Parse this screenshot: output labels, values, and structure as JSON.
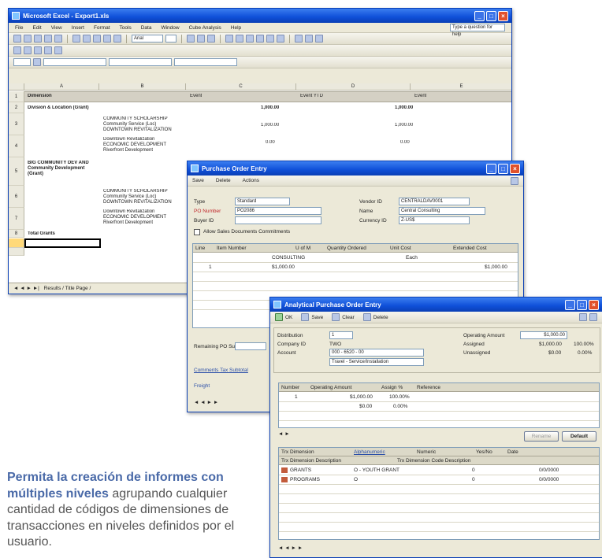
{
  "excel": {
    "title": "Microsoft Excel - Export1.xls",
    "menu": [
      "File",
      "Edit",
      "View",
      "Insert",
      "Format",
      "Tools",
      "Data",
      "Window",
      "Cube Analysis",
      "Help"
    ],
    "help_box": "Type a question for help",
    "font_name": "Arial",
    "columns": [
      "A",
      "B",
      "C",
      "D",
      "E"
    ],
    "rows": [
      {
        "num": "1",
        "a": "Dimension",
        "b": "Event",
        "c": "Event YTD",
        "d": "Event"
      },
      {
        "num": "2",
        "a": "Division & Location (Grant)",
        "b": "",
        "c": "1,000.00",
        "d": "1,000.00"
      },
      {
        "num": "3",
        "a": "",
        "b": "COMMUNITY SCHOLARSHIP\nCommunity Service (Loc)\nDOWNTOWN REVITALIZATION",
        "c": "1,000.00",
        "d": "1,000.00"
      },
      {
        "num": "4",
        "a": "",
        "b": "Downtown Revitalization\nECONOMIC DEVELOPMENT\nRiverfront Development",
        "c": "0.00",
        "d": "0.00"
      },
      {
        "num": "5",
        "a": "BIG COMMUNITY DEV AND\nCommunity Development\n(Grant)",
        "b": "",
        "c": "",
        "d": ""
      },
      {
        "num": "6",
        "a": "",
        "b": "COMMUNITY SCHOLARSHIP\nCommunity Service (Loc)\nDOWNTOWN REVITALIZATION",
        "c": "",
        "d": ""
      },
      {
        "num": "7",
        "a": "",
        "b": "Downtown Revitalization\nECONOMIC DEVELOPMENT\nRiverfront Development",
        "c": "",
        "d": ""
      },
      {
        "num": "8",
        "a": "Total Grants",
        "b": "",
        "c": "",
        "d": ""
      }
    ],
    "sheet_tab": "Results / Title Page /"
  },
  "po_entry": {
    "title": "Purchase Order Entry",
    "actions": [
      "Save",
      "Delete",
      "Actions"
    ],
    "fields": {
      "type_label": "Type",
      "type_value": "Standard",
      "po_number_label": "PO Number",
      "po_number_value": "PO2086",
      "buyer_label": "Buyer ID",
      "vendor_label": "Vendor ID",
      "vendor_value": "CENTRALDAV0001",
      "name_label": "Name",
      "name_value": "Central Consulting",
      "currency_label": "Currency ID",
      "currency_value": "Z-US$"
    },
    "allow_sales_docs": "Allow Sales Documents Commitments",
    "grid_headers": [
      "Line",
      "Item Number",
      "U of M",
      "Quantity Ordered",
      "Unit Cost",
      "Extended Cost"
    ],
    "grid_row": {
      "item": "CONSULTING",
      "uom": "Each",
      "qty": "1",
      "cost": "$1,000.00",
      "ext": "$1,000.00"
    },
    "remaining_label": "Remaining PO Subtotal",
    "tax_label": "Comments Tax Subtotal",
    "freight_label": "Freight"
  },
  "analytical": {
    "title": "Analytical Purchase Order Entry",
    "toolbar": [
      "OK",
      "Save",
      "Clear",
      "Delete"
    ],
    "fields": {
      "distribution_label": "Distribution",
      "distribution_value": "1",
      "company_label": "Company ID",
      "company_value": "TWO",
      "account_label": "Account",
      "account_value": "000 - 6520 - 00",
      "account_desc": "Travel - Service/Installation",
      "operating_amount_label": "Operating Amount",
      "operating_amount_value": "$1,000.00",
      "assigned_label": "Assigned",
      "assigned_value": "$1,000.00",
      "assigned_pct": "100.00%",
      "unassigned_label": "Unassigned",
      "unassigned_value": "$0.00",
      "unassigned_pct": "0.00%"
    },
    "assign_headers": [
      "Number",
      "Operating Amount",
      "Assign %",
      "Reference"
    ],
    "assign_rows": [
      {
        "num": "1",
        "amount": "$1,000.00",
        "pct": "100.00%"
      },
      {
        "num": "",
        "amount": "$0.00",
        "pct": "0.00%"
      }
    ],
    "buttons": [
      "Rename",
      "Default"
    ],
    "dim_headers": [
      "Trx Dimension",
      "Alphanumeric",
      "Numeric",
      "Yes/No",
      "Date"
    ],
    "dim_headers2": [
      "Trx Dimension Description",
      "Trx Dimension Code Description"
    ],
    "dim_rows": [
      {
        "dim": "GRANTS",
        "code": "O - YOUTH GRANT",
        "num": "0",
        "date": "0/0/0000"
      },
      {
        "dim": "PROGRAMS",
        "code": "O",
        "num": "0",
        "date": "0/0/0000"
      }
    ]
  },
  "caption": {
    "bold": "Permita la creación de informes con múltiples niveles",
    "text": " agrupando cualquier cantidad de códigos de dimensiones de transacciones en niveles definidos por el usuario."
  }
}
